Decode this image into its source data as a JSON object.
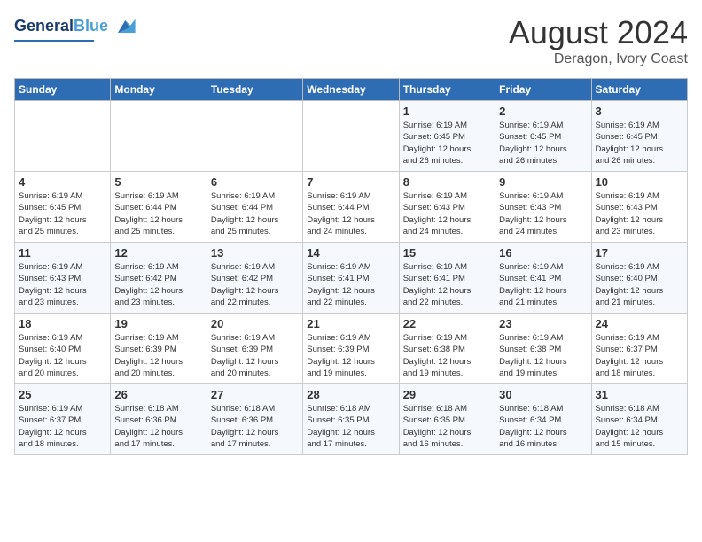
{
  "logo": {
    "line1": "General",
    "line2": "Blue"
  },
  "title": {
    "month_year": "August 2024",
    "location": "Deragon, Ivory Coast"
  },
  "days_of_week": [
    "Sunday",
    "Monday",
    "Tuesday",
    "Wednesday",
    "Thursday",
    "Friday",
    "Saturday"
  ],
  "weeks": [
    [
      {
        "day": "",
        "info": ""
      },
      {
        "day": "",
        "info": ""
      },
      {
        "day": "",
        "info": ""
      },
      {
        "day": "",
        "info": ""
      },
      {
        "day": "1",
        "info": "Sunrise: 6:19 AM\nSunset: 6:45 PM\nDaylight: 12 hours\nand 26 minutes."
      },
      {
        "day": "2",
        "info": "Sunrise: 6:19 AM\nSunset: 6:45 PM\nDaylight: 12 hours\nand 26 minutes."
      },
      {
        "day": "3",
        "info": "Sunrise: 6:19 AM\nSunset: 6:45 PM\nDaylight: 12 hours\nand 26 minutes."
      }
    ],
    [
      {
        "day": "4",
        "info": "Sunrise: 6:19 AM\nSunset: 6:45 PM\nDaylight: 12 hours\nand 25 minutes."
      },
      {
        "day": "5",
        "info": "Sunrise: 6:19 AM\nSunset: 6:44 PM\nDaylight: 12 hours\nand 25 minutes."
      },
      {
        "day": "6",
        "info": "Sunrise: 6:19 AM\nSunset: 6:44 PM\nDaylight: 12 hours\nand 25 minutes."
      },
      {
        "day": "7",
        "info": "Sunrise: 6:19 AM\nSunset: 6:44 PM\nDaylight: 12 hours\nand 24 minutes."
      },
      {
        "day": "8",
        "info": "Sunrise: 6:19 AM\nSunset: 6:43 PM\nDaylight: 12 hours\nand 24 minutes."
      },
      {
        "day": "9",
        "info": "Sunrise: 6:19 AM\nSunset: 6:43 PM\nDaylight: 12 hours\nand 24 minutes."
      },
      {
        "day": "10",
        "info": "Sunrise: 6:19 AM\nSunset: 6:43 PM\nDaylight: 12 hours\nand 23 minutes."
      }
    ],
    [
      {
        "day": "11",
        "info": "Sunrise: 6:19 AM\nSunset: 6:43 PM\nDaylight: 12 hours\nand 23 minutes."
      },
      {
        "day": "12",
        "info": "Sunrise: 6:19 AM\nSunset: 6:42 PM\nDaylight: 12 hours\nand 23 minutes."
      },
      {
        "day": "13",
        "info": "Sunrise: 6:19 AM\nSunset: 6:42 PM\nDaylight: 12 hours\nand 22 minutes."
      },
      {
        "day": "14",
        "info": "Sunrise: 6:19 AM\nSunset: 6:41 PM\nDaylight: 12 hours\nand 22 minutes."
      },
      {
        "day": "15",
        "info": "Sunrise: 6:19 AM\nSunset: 6:41 PM\nDaylight: 12 hours\nand 22 minutes."
      },
      {
        "day": "16",
        "info": "Sunrise: 6:19 AM\nSunset: 6:41 PM\nDaylight: 12 hours\nand 21 minutes."
      },
      {
        "day": "17",
        "info": "Sunrise: 6:19 AM\nSunset: 6:40 PM\nDaylight: 12 hours\nand 21 minutes."
      }
    ],
    [
      {
        "day": "18",
        "info": "Sunrise: 6:19 AM\nSunset: 6:40 PM\nDaylight: 12 hours\nand 20 minutes."
      },
      {
        "day": "19",
        "info": "Sunrise: 6:19 AM\nSunset: 6:39 PM\nDaylight: 12 hours\nand 20 minutes."
      },
      {
        "day": "20",
        "info": "Sunrise: 6:19 AM\nSunset: 6:39 PM\nDaylight: 12 hours\nand 20 minutes."
      },
      {
        "day": "21",
        "info": "Sunrise: 6:19 AM\nSunset: 6:39 PM\nDaylight: 12 hours\nand 19 minutes."
      },
      {
        "day": "22",
        "info": "Sunrise: 6:19 AM\nSunset: 6:38 PM\nDaylight: 12 hours\nand 19 minutes."
      },
      {
        "day": "23",
        "info": "Sunrise: 6:19 AM\nSunset: 6:38 PM\nDaylight: 12 hours\nand 19 minutes."
      },
      {
        "day": "24",
        "info": "Sunrise: 6:19 AM\nSunset: 6:37 PM\nDaylight: 12 hours\nand 18 minutes."
      }
    ],
    [
      {
        "day": "25",
        "info": "Sunrise: 6:19 AM\nSunset: 6:37 PM\nDaylight: 12 hours\nand 18 minutes."
      },
      {
        "day": "26",
        "info": "Sunrise: 6:18 AM\nSunset: 6:36 PM\nDaylight: 12 hours\nand 17 minutes."
      },
      {
        "day": "27",
        "info": "Sunrise: 6:18 AM\nSunset: 6:36 PM\nDaylight: 12 hours\nand 17 minutes."
      },
      {
        "day": "28",
        "info": "Sunrise: 6:18 AM\nSunset: 6:35 PM\nDaylight: 12 hours\nand 17 minutes."
      },
      {
        "day": "29",
        "info": "Sunrise: 6:18 AM\nSunset: 6:35 PM\nDaylight: 12 hours\nand 16 minutes."
      },
      {
        "day": "30",
        "info": "Sunrise: 6:18 AM\nSunset: 6:34 PM\nDaylight: 12 hours\nand 16 minutes."
      },
      {
        "day": "31",
        "info": "Sunrise: 6:18 AM\nSunset: 6:34 PM\nDaylight: 12 hours\nand 15 minutes."
      }
    ]
  ]
}
